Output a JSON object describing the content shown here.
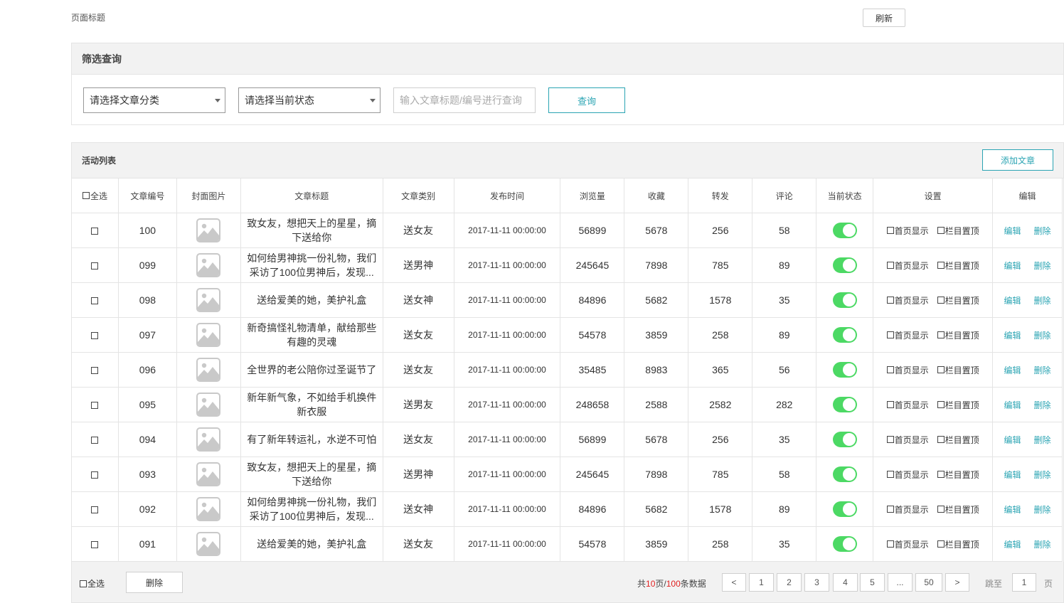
{
  "page": {
    "title": "页面标题",
    "refresh_label": "刷新"
  },
  "filter": {
    "title": "筛选查询",
    "category_select": "请选择文章分类",
    "status_select": "请选择当前状态",
    "search_placeholder": "输入文章标题/编号进行查询",
    "query_label": "查询"
  },
  "list": {
    "title": "活动列表",
    "add_label": "添加文章",
    "select_all": "全选",
    "columns": [
      "文章编号",
      "封面图片",
      "文章标题",
      "文章类别",
      "发布时间",
      "浏览量",
      "收藏",
      "转发",
      "评论",
      "当前状态",
      "设置",
      "编辑"
    ],
    "setting_labels": [
      "首页显示",
      "栏目置顶"
    ],
    "edit_label": "编辑",
    "delete_label": "删除",
    "rows": [
      {
        "id": "100",
        "title": "致女友，想把天上的星星，摘下送给你",
        "category": "送女友",
        "date": "2017-11-11 00:00:00",
        "views": "56899",
        "favorites": "5678",
        "shares": "256",
        "comments": "58"
      },
      {
        "id": "099",
        "title": "如何给男神挑一份礼物，我们采访了100位男神后，发现...",
        "category": "送男神",
        "date": "2017-11-11 00:00:00",
        "views": "245645",
        "favorites": "7898",
        "shares": "785",
        "comments": "89"
      },
      {
        "id": "098",
        "title": "送给爱美的她，美护礼盒",
        "category": "送女神",
        "date": "2017-11-11 00:00:00",
        "views": "84896",
        "favorites": "5682",
        "shares": "1578",
        "comments": "35"
      },
      {
        "id": "097",
        "title": "新奇搞怪礼物清单，献给那些有趣的灵魂",
        "category": "送女友",
        "date": "2017-11-11 00:00:00",
        "views": "54578",
        "favorites": "3859",
        "shares": "258",
        "comments": "89"
      },
      {
        "id": "096",
        "title": "全世界的老公陪你过圣诞节了",
        "category": "送女友",
        "date": "2017-11-11 00:00:00",
        "views": "35485",
        "favorites": "8983",
        "shares": "365",
        "comments": "56"
      },
      {
        "id": "095",
        "title": "新年新气象，不如给手机换件新衣服",
        "category": "送男友",
        "date": "2017-11-11 00:00:00",
        "views": "248658",
        "favorites": "2588",
        "shares": "2582",
        "comments": "282"
      },
      {
        "id": "094",
        "title": "有了新年转运礼，水逆不可怕",
        "category": "送女友",
        "date": "2017-11-11 00:00:00",
        "views": "56899",
        "favorites": "5678",
        "shares": "256",
        "comments": "35"
      },
      {
        "id": "093",
        "title": "致女友，想把天上的星星，摘下送给你",
        "category": "送男神",
        "date": "2017-11-11 00:00:00",
        "views": "245645",
        "favorites": "7898",
        "shares": "785",
        "comments": "58"
      },
      {
        "id": "092",
        "title": "如何给男神挑一份礼物，我们采访了100位男神后，发现...",
        "category": "送女神",
        "date": "2017-11-11 00:00:00",
        "views": "84896",
        "favorites": "5682",
        "shares": "1578",
        "comments": "89"
      },
      {
        "id": "091",
        "title": "送给爱美的她，美护礼盒",
        "category": "送女友",
        "date": "2017-11-11 00:00:00",
        "views": "54578",
        "favorites": "3859",
        "shares": "258",
        "comments": "35"
      }
    ]
  },
  "footer": {
    "select_all": "全选",
    "delete_label": "删除",
    "summary_prefix": "共",
    "total_pages": "10",
    "summary_mid": "页/",
    "total_records": "100",
    "summary_suffix": "条数据",
    "prev_label": "<",
    "next_label": ">",
    "pages": [
      "1",
      "2",
      "3",
      "4",
      "5",
      "...",
      "50"
    ],
    "jump_label": "跳至",
    "jump_value": "1",
    "page_unit": "页"
  },
  "colors": {
    "accent": "#2aa4b3",
    "toggle_on": "#4cd964",
    "highlight": "#e02020"
  },
  "icons": {
    "cover": "image-placeholder-icon"
  }
}
